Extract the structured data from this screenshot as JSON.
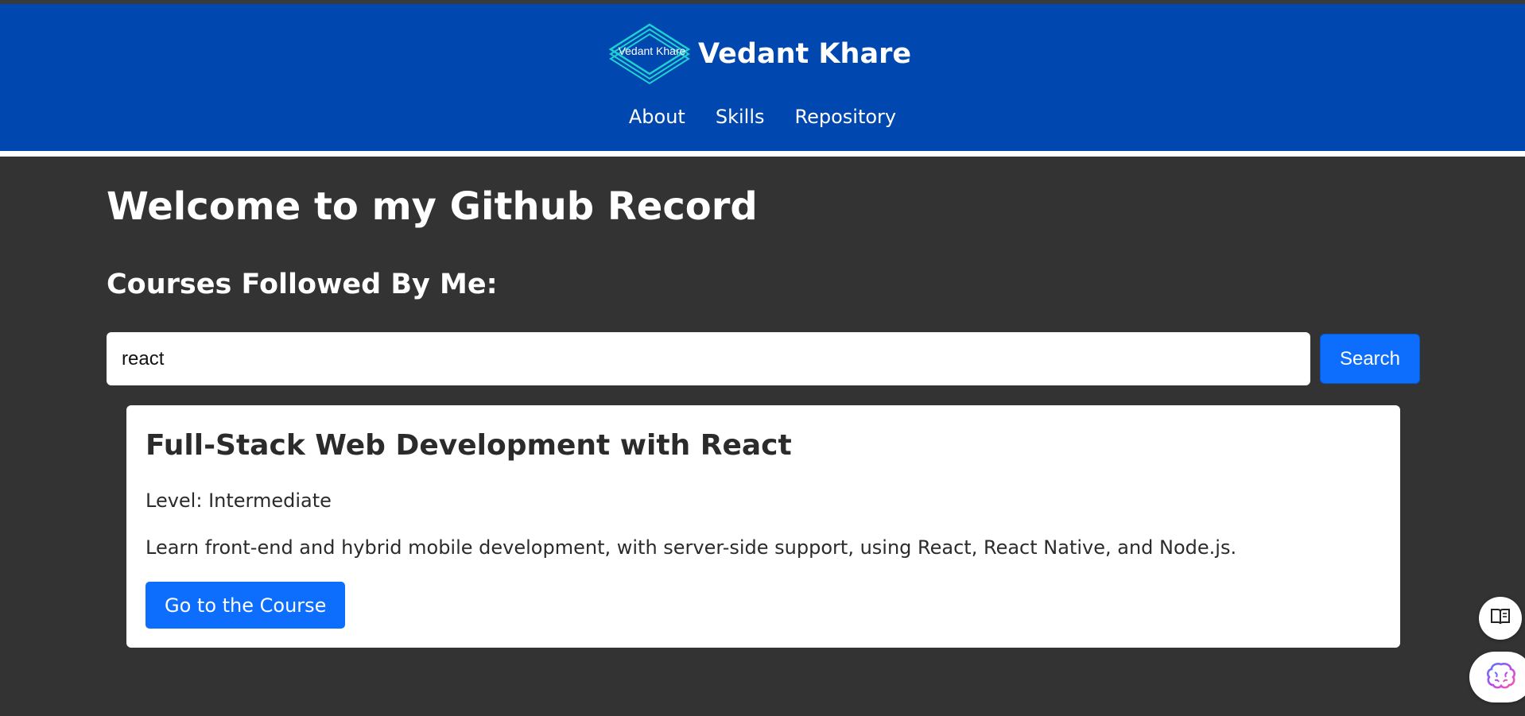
{
  "header": {
    "logo_text": "Vedant Khare",
    "brand_name": "Vedant Khare",
    "nav": [
      "About",
      "Skills",
      "Repository"
    ]
  },
  "main": {
    "title": "Welcome to my Github Record",
    "section_title": "Courses Followed By Me:",
    "search": {
      "value": "react",
      "button_label": "Search"
    },
    "course": {
      "title": "Full-Stack Web Development with React",
      "level": "Level: Intermediate",
      "description": "Learn front-end and hybrid mobile development, with server-side support, using React, React Native, and Node.js.",
      "button_label": "Go to the Course"
    }
  },
  "floating": {
    "reader_icon": "book-icon",
    "ai_icon": "brain-icon"
  },
  "colors": {
    "header_bg": "#0047b0",
    "page_bg": "#333333",
    "primary_button": "#0d6efd",
    "logo_accent": "#1fd1d1"
  }
}
